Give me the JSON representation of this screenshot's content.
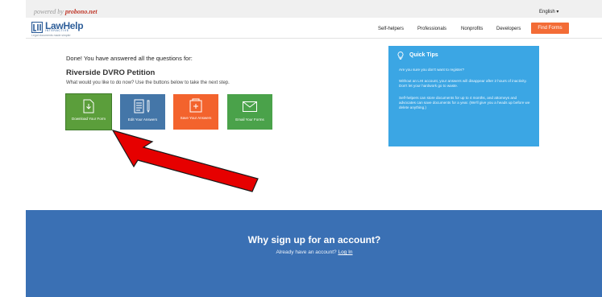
{
  "topbar": {
    "powered_prefix": "powered by",
    "powered_brand": "probono.net",
    "language": "English ▾"
  },
  "header": {
    "logo_name": "LawHelp",
    "logo_sub": "INTERACTIVE",
    "logo_tagline": "Legal documents made simpler",
    "nav": [
      "Self-helpers",
      "Professionals",
      "Nonprofits",
      "Developers"
    ],
    "cta": "Find Forms"
  },
  "main": {
    "done_heading": "Done! You have answered all the questions for:",
    "form_title": "Riverside DVRO Petition",
    "prompt": "What would you like to do now? Use the buttons below to take the next step.",
    "actions": [
      {
        "label": "Download Your Form",
        "icon": "download-document-icon",
        "color": "#5b9e3b"
      },
      {
        "label": "Edit Your Answers",
        "icon": "edit-document-icon",
        "color": "#4476a8"
      },
      {
        "label": "Save Your Answers",
        "icon": "save-document-icon",
        "color": "#f3632d"
      },
      {
        "label": "Email Your Forms",
        "icon": "envelope-icon",
        "color": "#4aa24a"
      }
    ]
  },
  "tips": {
    "title": "Quick Tips",
    "icon": "lightbulb-icon",
    "paragraphs": [
      "Are you sure you don't want to register?",
      "Without an LHI account, your answers will disappear after 2 hours of inactivity. Don't let your hardwork go to waste.",
      "Self-helpers can store documents for up to 4 months, and attorneys and advocates can save documents for a year. (We'll give you a heads up before we delete anything.)"
    ],
    "color": "#3ba6e4"
  },
  "annotation": {
    "type": "red-arrow",
    "color": "#e60000",
    "points_to": "Download Your Form"
  },
  "signup": {
    "title": "Why sign up for an account?",
    "have_account": "Already have an account?",
    "login_link": "Log In",
    "color": "#3a70b4"
  }
}
